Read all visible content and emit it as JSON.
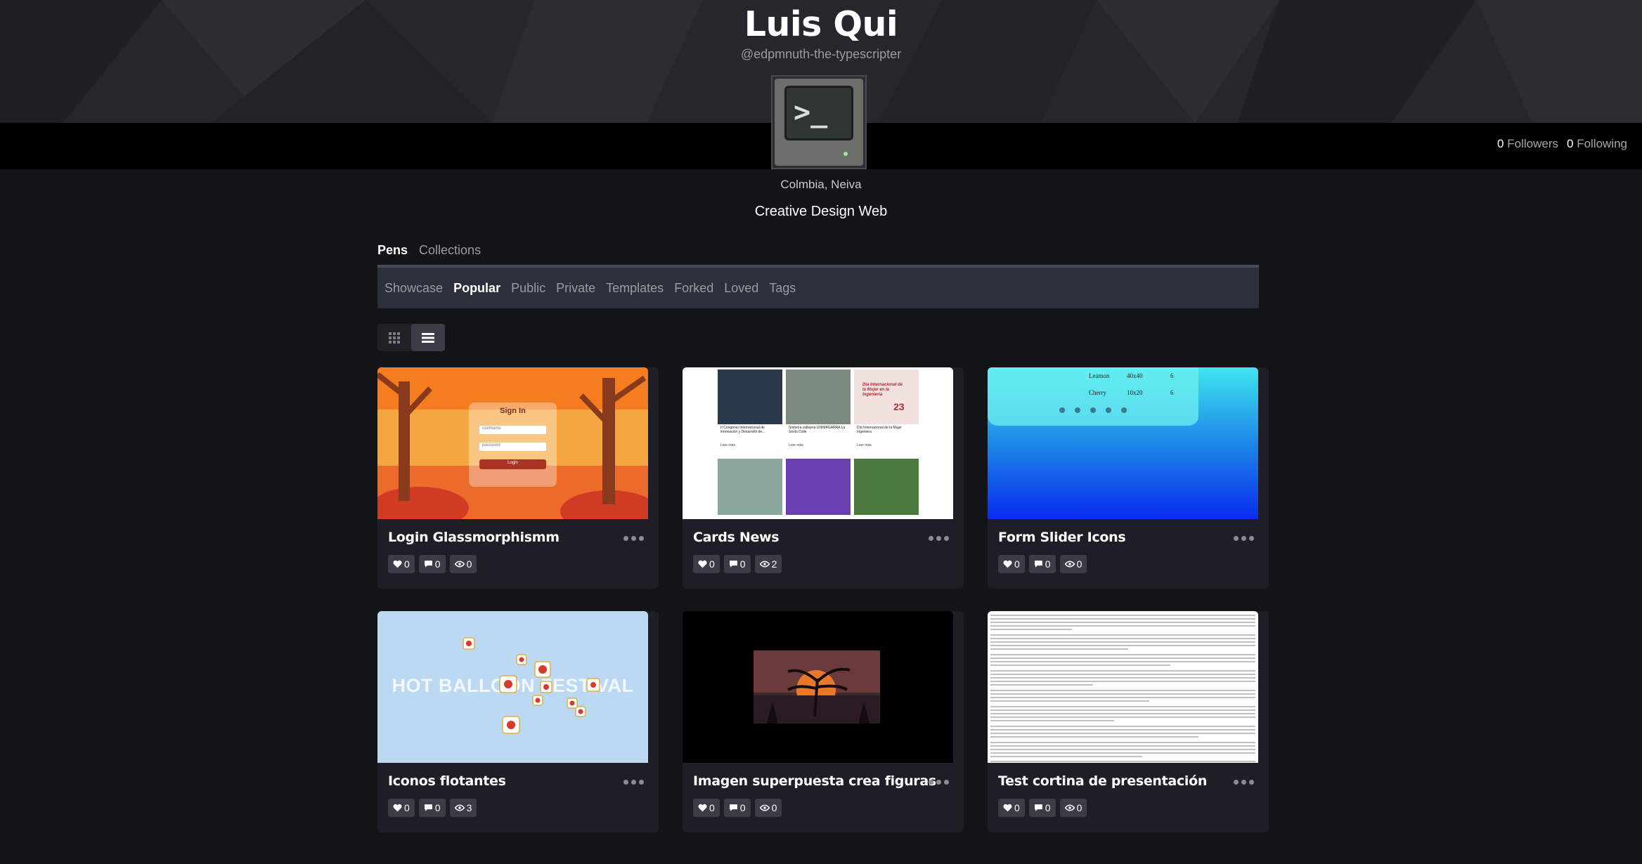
{
  "profile": {
    "name": "Luis Qui",
    "handle": "@edpmnuth-the-typescripter",
    "location": "Colmbia, Neiva",
    "tagline": "Creative Design Web",
    "avatar_prompt": ">_",
    "followers_count": "0",
    "followers_label": "Followers",
    "following_count": "0",
    "following_label": "Following"
  },
  "tabs": [
    {
      "label": "Pens",
      "active": true
    },
    {
      "label": "Collections",
      "active": false
    }
  ],
  "subnav": [
    {
      "label": "Showcase",
      "active": false
    },
    {
      "label": "Popular",
      "active": true
    },
    {
      "label": "Public",
      "active": false
    },
    {
      "label": "Private",
      "active": false
    },
    {
      "label": "Templates",
      "active": false
    },
    {
      "label": "Forked",
      "active": false
    },
    {
      "label": "Loved",
      "active": false
    },
    {
      "label": "Tags",
      "active": false
    }
  ],
  "view_toggle": {
    "grid_icon": "grid-icon",
    "list_icon": "list-icon",
    "selected": "list"
  },
  "pens": [
    {
      "title": "Login Glassmorphismm",
      "likes": "0",
      "comments": "0",
      "views": "0",
      "preview": {
        "heading": "Sign In",
        "username": "username",
        "password": "password",
        "button": "Login"
      }
    },
    {
      "title": "Cards News",
      "likes": "0",
      "comments": "0",
      "views": "2",
      "preview": {
        "items": [
          "II Congreso Internacional de Innovación y Desarrollo de...",
          "Sinfonía callejera UNIMAGARRA La Sexta Calle",
          "Día Internacional de la Mujer Ingeniera"
        ],
        "more": "Leer más",
        "feature": "Día Internacional de la Mujer en la Ingeniería",
        "feature_number": "23"
      }
    },
    {
      "title": "Form Slider Icons",
      "likes": "0",
      "comments": "0",
      "views": "0",
      "preview": {
        "rows": [
          {
            "name": "Leamon",
            "value": "40x40",
            "mark": "6"
          },
          {
            "name": "Cherry",
            "value": "10x20",
            "mark": "6"
          }
        ]
      }
    },
    {
      "title": "Iconos flotantes",
      "likes": "0",
      "comments": "0",
      "views": "3",
      "preview": {
        "text": "HOT BALLOON FESTIVAL"
      }
    },
    {
      "title": "Imagen superpuesta crea figuras",
      "likes": "0",
      "comments": "0",
      "views": "0",
      "preview": {}
    },
    {
      "title": "Test cortina de presentación",
      "likes": "0",
      "comments": "0",
      "views": "0",
      "preview": {}
    }
  ],
  "icons": {
    "like": "heart-icon",
    "comment": "comment-icon",
    "view": "eye-icon",
    "more": "more-dots-icon"
  },
  "colors": {
    "background": "#131417",
    "card": "#1e1f26",
    "subnav": "#2c303a",
    "stat": "#3a3d47",
    "muted": "#9a9ba3"
  }
}
